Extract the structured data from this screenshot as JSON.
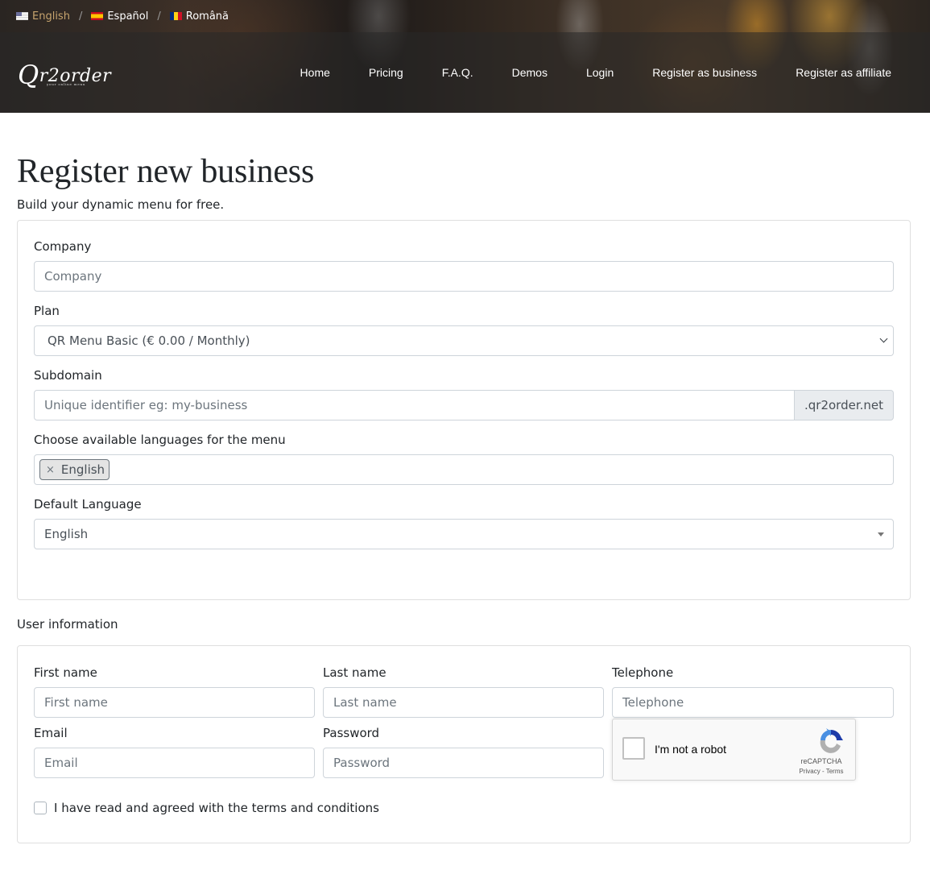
{
  "languages": [
    {
      "label": "English",
      "flag": "us-flag",
      "active": true
    },
    {
      "label": "Español",
      "flag": "es-flag",
      "active": false
    },
    {
      "label": "Română",
      "flag": "ro-flag",
      "active": false
    }
  ],
  "language_separator": "/",
  "brand": {
    "logo_text": "Qr2order",
    "logo_initial": "Q",
    "logo_rest": "r2order",
    "tagline": "your online menu"
  },
  "nav": {
    "items": [
      "Home",
      "Pricing",
      "F.A.Q.",
      "Demos",
      "Login",
      "Register as business",
      "Register as affiliate"
    ]
  },
  "page": {
    "title": "Register new business",
    "subtitle": "Build your dynamic menu for free."
  },
  "business_form": {
    "company": {
      "label": "Company",
      "placeholder": "Company",
      "value": ""
    },
    "plan": {
      "label": "Plan",
      "selected": "QR Menu Basic (€ 0.00 / Monthly)"
    },
    "subdomain": {
      "label": "Subdomain",
      "placeholder": "Unique identifier eg: my-business",
      "value": "",
      "suffix": ".qr2order.net"
    },
    "menu_languages": {
      "label": "Choose available languages for the menu",
      "selected_tags": [
        "English"
      ],
      "remove_glyph": "×"
    },
    "default_language": {
      "label": "Default Language",
      "selected": "English"
    }
  },
  "user_section": {
    "title": "User information",
    "first_name": {
      "label": "First name",
      "placeholder": "First name",
      "value": ""
    },
    "last_name": {
      "label": "Last name",
      "placeholder": "Last name",
      "value": ""
    },
    "telephone": {
      "label": "Telephone",
      "placeholder": "Telephone",
      "value": ""
    },
    "email": {
      "label": "Email",
      "placeholder": "Email",
      "value": ""
    },
    "password": {
      "label": "Password",
      "placeholder": "Password",
      "value": ""
    },
    "recaptcha": {
      "label": "I'm not a robot",
      "brand": "reCAPTCHA",
      "privacy": "Privacy",
      "separator": " - ",
      "terms": "Terms",
      "checked": false
    },
    "terms": {
      "label": "I have read and agreed with the terms and conditions",
      "checked": false
    }
  },
  "colors": {
    "active_language": "#c7a46e",
    "nav_text": "#ffffff",
    "input_border": "#ced4da",
    "addon_bg": "#e9ecef",
    "recaptcha_blue": "#4a90e2",
    "recaptcha_dark_blue": "#1c3aa9",
    "recaptcha_gray": "#b0b0b0"
  }
}
